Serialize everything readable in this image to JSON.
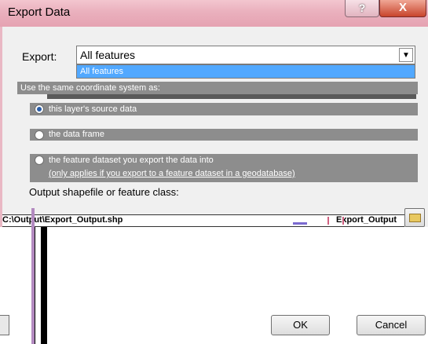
{
  "window": {
    "title": "Export Data",
    "help_glyph": "?",
    "close_glyph": "X"
  },
  "export": {
    "label": "Export:",
    "selected": "All features",
    "arrow_icon": "chevron-down-icon",
    "dropdown_highlight": "All features"
  },
  "use_coord": {
    "label": "Use the same coordinate system as:"
  },
  "options": [
    {
      "label": "this layer's source data",
      "selected": true
    },
    {
      "label": "the data frame",
      "selected": false
    },
    {
      "label": "the feature dataset you export the data into",
      "selected": false
    }
  ],
  "options_note": "(only applies if you export to a feature dataset in a geodatabase)",
  "output": {
    "label": "Output shapefile or feature class:",
    "path_left": "C:\\Output\\Export_Output.shp",
    "path_right": "Export_Output",
    "browse_icon": "folder-open-icon"
  },
  "buttons": {
    "ok": "OK",
    "cancel": "Cancel"
  },
  "colors": {
    "title_bar": "#e5a2b2",
    "close_button": "#c8442c",
    "selection": "#3399ff",
    "dialog_bg": "#f0f0f0"
  }
}
